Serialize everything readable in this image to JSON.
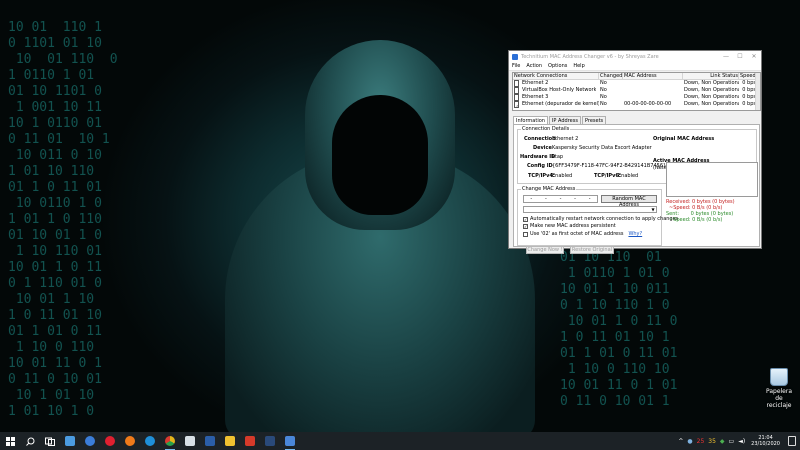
{
  "window": {
    "title": "Technitium MAC Address Changer v6 - by Shreyas Zare",
    "menu": [
      "File",
      "Action",
      "Options",
      "Help"
    ],
    "controls": {
      "minimize": "—",
      "maximize": "☐",
      "close": "✕"
    }
  },
  "connections": {
    "headers": [
      "Network Connections",
      "Changed",
      "MAC Address",
      "Link Status",
      "Speed"
    ],
    "rows": [
      {
        "name": "Ethernet 2",
        "changed": "No",
        "mac": "",
        "status": "Down, Non Operational",
        "speed": "0 bps",
        "checked": false
      },
      {
        "name": "VirtualBox Host-Only Network",
        "changed": "No",
        "mac": "",
        "status": "Down, Non Operational",
        "speed": "0 bps",
        "checked": false
      },
      {
        "name": "Ethernet 3",
        "changed": "No",
        "mac": "",
        "status": "Down, Non Operational",
        "speed": "0 bps",
        "checked": false
      },
      {
        "name": "Ethernet (depurador de kernel)",
        "changed": "No",
        "mac": "00-00-00-00-00-00",
        "status": "Down, Non Operational",
        "speed": "0 bps",
        "checked": true
      }
    ]
  },
  "tabs": [
    "Information",
    "IP Address",
    "Presets"
  ],
  "details": {
    "group_title": "Connection Details",
    "connection_label": "Connection",
    "connection_value": "Ethernet 2",
    "device_label": "Device",
    "device_value": "Kaspersky Security Data Escort Adapter",
    "hardware_label": "Hardware ID",
    "hardware_value": "ktap",
    "config_label": "Config ID",
    "config_value": "{6FF3479F-F118-47FC-94F2-B429141B7456}",
    "tcpv4_label": "TCP/IPv4:",
    "tcpv4_value": "Enabled",
    "tcpv6_label": "TCP/IPv6:",
    "tcpv6_value": "Enabled",
    "original_mac_label": "Original MAC Address",
    "active_mac_label": "Active MAC Address",
    "active_mac_value": "(Network Connection Disabled)"
  },
  "change_mac": {
    "group_title": "Change MAC Address",
    "octet_sep": "-",
    "random_button": "Random MAC Address",
    "options": [
      {
        "label": "Automatically restart network connection to apply changes",
        "checked": true
      },
      {
        "label": "Make new MAC address persistent",
        "checked": true
      },
      {
        "label": "Use '02' as first octet of MAC address",
        "checked": false
      }
    ],
    "why_link": "Why?",
    "change_now": "Change Now !",
    "restore_original": "Restore Original"
  },
  "stats": {
    "received_label": "Received:",
    "received_value": "0 bytes (0 bytes)",
    "recv_speed_label": "~Speed:",
    "recv_speed_value": "0 B/s (0 b/s)",
    "sent_label": "Sent:",
    "sent_value": "0 bytes (0 bytes)",
    "sent_speed_label": "~Speed:",
    "sent_speed_value": "0 B/s (0 b/s)"
  },
  "desktop": {
    "recycle_bin_label": "Papelera de reciclaje"
  },
  "taskbar": {
    "icons": [
      {
        "name": "start-icon",
        "color": "#ffffff"
      },
      {
        "name": "search-icon",
        "color": "#ffffff"
      },
      {
        "name": "task-view-icon",
        "color": "#ffffff"
      },
      {
        "name": "mail-icon",
        "color": "#4b9be0"
      },
      {
        "name": "app-blue-icon",
        "color": "#3b7dd8"
      },
      {
        "name": "opera-icon",
        "color": "#e02030"
      },
      {
        "name": "firefox-icon",
        "color": "#f07a1a"
      },
      {
        "name": "edge-icon",
        "color": "#1f8fd8"
      },
      {
        "name": "chrome-icon",
        "color": "#e4b41a"
      },
      {
        "name": "notepad-icon",
        "color": "#d8e0e6"
      },
      {
        "name": "word-icon",
        "color": "#2b5ea8"
      },
      {
        "name": "file-explorer-icon",
        "color": "#f0c030"
      },
      {
        "name": "acrobat-icon",
        "color": "#d63a2a"
      },
      {
        "name": "photoshop-icon",
        "color": "#2a4a7a"
      },
      {
        "name": "mac-changer-icon",
        "color": "#4a86d8"
      }
    ],
    "tray": {
      "chevron": "^",
      "badge_red": "25",
      "badge_yellow": "35"
    },
    "time": "21:04",
    "date": "23/10/2020"
  }
}
